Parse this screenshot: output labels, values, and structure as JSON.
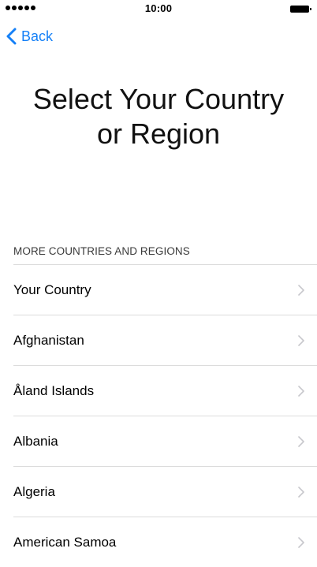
{
  "status_bar": {
    "time": "10:00",
    "signal_bars": 5
  },
  "navigation": {
    "back_label": "Back"
  },
  "title": {
    "line1": "Select Your Country",
    "line2": "or Region"
  },
  "section": {
    "header": "MORE COUNTRIES AND REGIONS",
    "items": [
      {
        "label": "Your Country"
      },
      {
        "label": "Afghanistan"
      },
      {
        "label": "Åland Islands"
      },
      {
        "label": "Albania"
      },
      {
        "label": "Algeria"
      },
      {
        "label": "American Samoa"
      }
    ]
  },
  "colors": {
    "accent": "#1580f7",
    "separator": "#dcdcdc",
    "chevron": "#c7c7cc"
  }
}
